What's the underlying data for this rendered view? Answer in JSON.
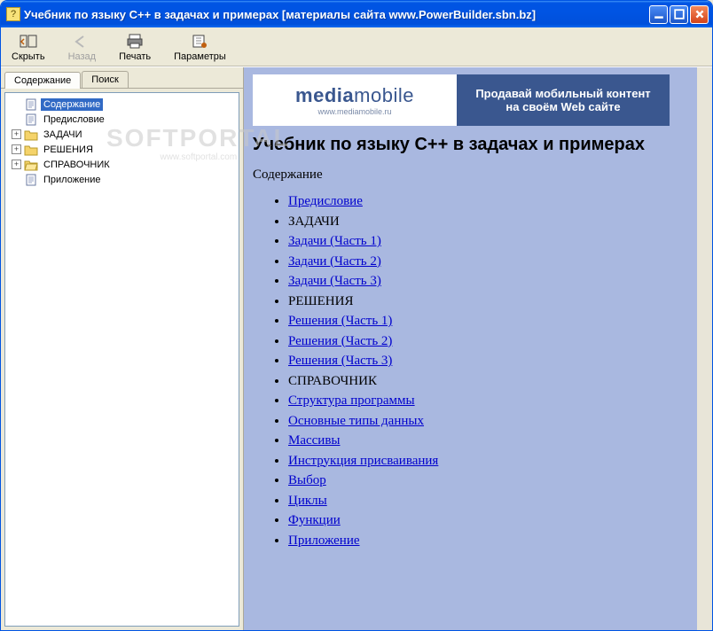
{
  "titlebar": {
    "title": "Учебник по языку C++ в задачах и примерах [материалы сайта www.PowerBuilder.sbn.bz]"
  },
  "toolbar": {
    "hide": "Скрыть",
    "back": "Назад",
    "print": "Печать",
    "options": "Параметры"
  },
  "tabs": {
    "contents": "Содержание",
    "search": "Поиск"
  },
  "tree": {
    "items": [
      {
        "label": "Содержание",
        "icon": "page",
        "depth": 1,
        "selected": true,
        "children": false
      },
      {
        "label": "Предисловие",
        "icon": "page",
        "depth": 1,
        "children": false
      },
      {
        "label": "ЗАДАЧИ",
        "icon": "folder",
        "depth": 1,
        "children": true
      },
      {
        "label": "РЕШЕНИЯ",
        "icon": "folder",
        "depth": 1,
        "children": true
      },
      {
        "label": "СПРАВОЧНИК",
        "icon": "folder-open",
        "depth": 1,
        "children": true
      },
      {
        "label": "Приложение",
        "icon": "page",
        "depth": 1,
        "children": false
      }
    ]
  },
  "banner": {
    "brand_bold": "media",
    "brand_light": "mobile",
    "brand_sub": "www.mediamobile.ru",
    "line1": "Продавай мобильный контент",
    "line2": "на своём Web сайте"
  },
  "page": {
    "title": "Учебник по языку C++ в задачах и примерах",
    "section": "Содержание",
    "items": [
      {
        "label": "Предисловие",
        "link": true
      },
      {
        "label": "ЗАДАЧИ",
        "link": false
      },
      {
        "label": "Задачи (Часть 1)",
        "link": true
      },
      {
        "label": "Задачи (Часть 2)",
        "link": true
      },
      {
        "label": "Задачи (Часть 3)",
        "link": true
      },
      {
        "label": "РЕШЕНИЯ",
        "link": false
      },
      {
        "label": "Решения (Часть 1)",
        "link": true
      },
      {
        "label": "Решения (Часть 2)",
        "link": true
      },
      {
        "label": "Решения (Часть 3)",
        "link": true
      },
      {
        "label": "СПРАВОЧНИК",
        "link": false
      },
      {
        "label": "Структура программы",
        "link": true
      },
      {
        "label": "Основные типы данных",
        "link": true
      },
      {
        "label": "Массивы",
        "link": true
      },
      {
        "label": "Инструкция присваивания",
        "link": true
      },
      {
        "label": "Выбор",
        "link": true
      },
      {
        "label": "Циклы",
        "link": true
      },
      {
        "label": "Функции",
        "link": true
      },
      {
        "label": "Приложение",
        "link": true
      }
    ]
  },
  "watermark": {
    "big": "SOFTPORTAL",
    "small": "www.softportal.com"
  }
}
